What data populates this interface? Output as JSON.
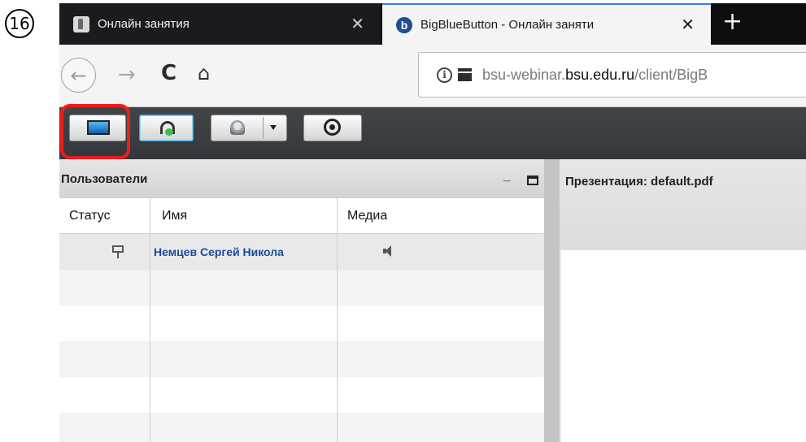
{
  "step_badge": "16",
  "browser": {
    "tabs": [
      {
        "title": "Онлайн занятия",
        "active": false,
        "favicon": "moodle-favicon-icon"
      },
      {
        "title": "BigBlueButton - Онлайн заняти",
        "active": true,
        "favicon": "bigbluebutton-favicon-icon"
      }
    ],
    "tab_close_glyph": "✕",
    "new_tab_glyph": "+",
    "nav": {
      "back_glyph": "←",
      "forward_glyph": "→",
      "reload_glyph": "C",
      "home_glyph": "⌂"
    },
    "url": {
      "prefix": "bsu-webinar.",
      "domain": "bsu.edu.ru",
      "path": "/client/BigB"
    }
  },
  "toolbar": {
    "buttons": [
      "screen-share",
      "audio",
      "webcam",
      "record"
    ],
    "highlighted_button": "screen-share",
    "highlight_color": "#ef1c1c"
  },
  "users_panel": {
    "title": "Пользователи",
    "minimize_glyph": "_",
    "columns": [
      "Статус",
      "Имя",
      "Медиа"
    ],
    "users": [
      {
        "status_icon": "presenter-icon",
        "name": "Немцев Сергей Никола",
        "media_icon": "speaker-icon"
      }
    ]
  },
  "presentation_panel": {
    "title": "Презентация: default.pdf"
  },
  "colors": {
    "tab_bar": "#0e0e10",
    "toolbar": "#3a3d41",
    "user_name": "#1a4b9a",
    "active_tab_accent": "#3b7be0"
  }
}
